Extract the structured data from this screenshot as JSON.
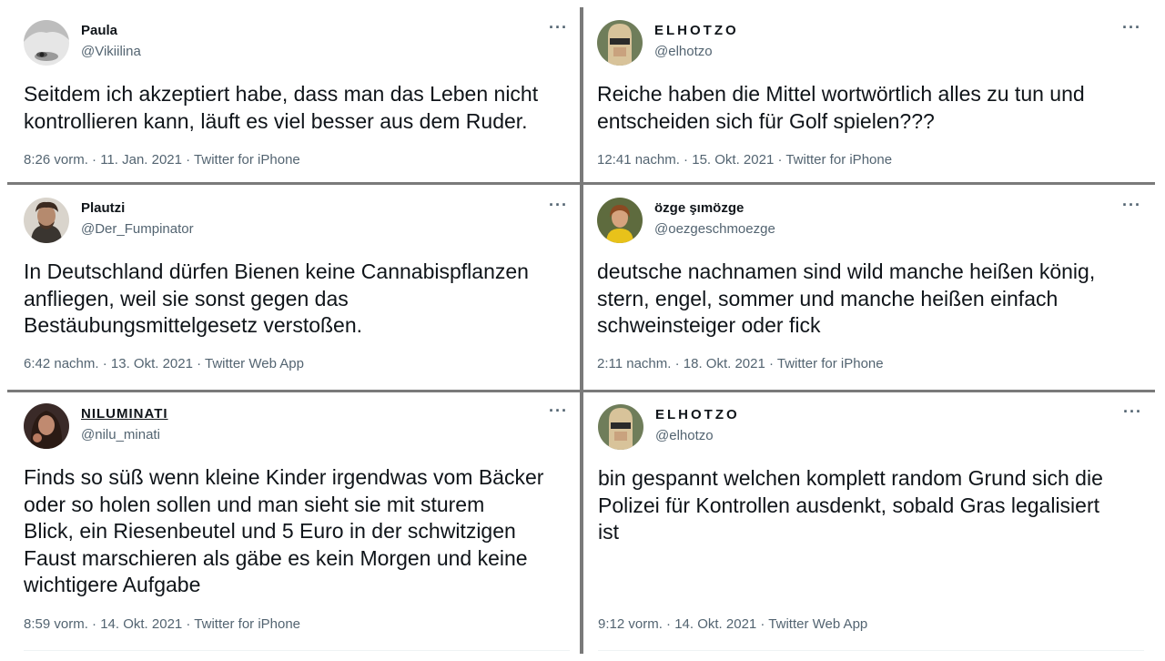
{
  "tweets": [
    {
      "name": "Paula",
      "handle": "@Vikiilina",
      "text": "Seitdem ich akzeptiert habe, dass man das Leben nicht\nkontrollieren kann, läuft es viel besser aus dem Ruder.",
      "meta": "8:26 vorm. · 11. Jan. 2021 · Twitter for iPhone",
      "more": "···"
    },
    {
      "name": "ELHOTZO",
      "handle": "@elhotzo",
      "text": "Reiche haben die Mittel wortwörtlich alles zu tun und\nentscheiden sich für Golf spielen???",
      "meta": "12:41 nachm. · 15. Okt. 2021 · Twitter for iPhone",
      "more": "···"
    },
    {
      "name": "Plautzi",
      "handle": "@Der_Fumpinator",
      "text": "In Deutschland dürfen Bienen keine Cannabispflanzen\nanfliegen, weil sie sonst gegen das\nBestäubungsmittelgesetz verstoßen.",
      "meta": "6:42 nachm. · 13. Okt. 2021 · Twitter Web App",
      "more": "···"
    },
    {
      "name": "özge şımözge",
      "handle": "@oezgeschmoezge",
      "text": "deutsche nachnamen sind wild manche heißen könig,\nstern, engel, sommer und manche heißen einfach\nschweinsteiger oder fick",
      "meta": "2:11 nachm. · 18. Okt. 2021 · Twitter for iPhone",
      "more": "···"
    },
    {
      "name": "NILUMINATI",
      "handle": "@nilu_minati",
      "text": "Finds so süß wenn kleine Kinder irgendwas vom Bäcker\noder so holen sollen und man sieht sie mit sturem\nBlick, ein Riesenbeutel und 5 Euro in der schwitzigen\nFaust marschieren als gäbe es kein Morgen und keine\nwichtigere Aufgabe",
      "meta": "8:59 vorm. · 14. Okt. 2021 · Twitter for iPhone",
      "more": "···"
    },
    {
      "name": "ELHOTZO",
      "handle": "@elhotzo",
      "text": "bin gespannt welchen komplett random Grund sich die\nPolizei für Kontrollen ausdenkt, sobald Gras legalisiert\nist",
      "meta": "9:12 vorm. · 14. Okt. 2021 · Twitter Web App",
      "more": "···"
    }
  ]
}
